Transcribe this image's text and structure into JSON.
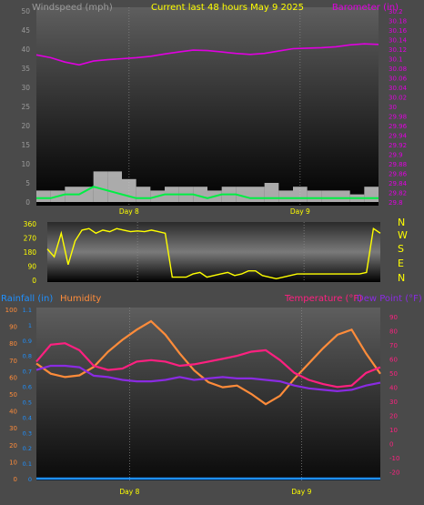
{
  "header": {
    "left_label": "Windspeed (mph)",
    "center_label": "Current last 48 hours May 9 2025",
    "right_label": "Barometer (in)"
  },
  "colors": {
    "background": "#4a4a4a",
    "plot_top": "#5a5a5a",
    "plot_bottom": "#000000",
    "barometer": "#e000e0",
    "wind_gust": "#c8c8c8",
    "wind_avg": "#00ee44",
    "direction": "#ffff00",
    "rainfall": "#1e90ff",
    "humidity": "#ff8c3a",
    "temperature": "#ff2080",
    "dewpoint": "#8a2be2",
    "day_label": "#ffff00",
    "axis_text": "#888888"
  },
  "chart_data": [
    {
      "id": "wind_baro",
      "type": "line",
      "x_range_hours": [
        0,
        48
      ],
      "x_ticks": [
        {
          "hour": 13,
          "label": "Day 8"
        },
        {
          "hour": 37,
          "label": "Day 9"
        }
      ],
      "left_axis": {
        "label": "Windspeed (mph)",
        "ylim": [
          0,
          50
        ],
        "ticks": [
          0,
          5,
          10,
          15,
          20,
          25,
          30,
          35,
          40,
          45,
          50
        ]
      },
      "right_axis": {
        "label": "Barometer (in)",
        "ylim": [
          29.8,
          30.2
        ],
        "ticks": [
          "29.8",
          "29.82",
          "29.84",
          "29.86",
          "29.88",
          "29.9",
          "29.92",
          "29.94",
          "29.96",
          "29.98",
          "30",
          "30.02",
          "30.04",
          "30.06",
          "30.08",
          "30.1",
          "30.12",
          "30.14",
          "30.16",
          "30.18",
          "30.2"
        ]
      },
      "series": [
        {
          "name": "Barometer",
          "axis": "right",
          "x": [
            0,
            2,
            4,
            6,
            8,
            10,
            12,
            14,
            16,
            18,
            20,
            22,
            24,
            26,
            28,
            30,
            32,
            34,
            36,
            38,
            40,
            42,
            44,
            46,
            48
          ],
          "values": [
            30.108,
            30.102,
            30.093,
            30.087,
            30.095,
            30.098,
            30.1,
            30.102,
            30.105,
            30.11,
            30.114,
            30.118,
            30.117,
            30.114,
            30.111,
            30.109,
            30.111,
            30.116,
            30.121,
            30.122,
            30.123,
            30.125,
            30.129,
            30.131,
            30.13
          ]
        },
        {
          "name": "Wind gust",
          "axis": "left",
          "x": [
            0,
            2,
            4,
            6,
            8,
            10,
            12,
            14,
            16,
            18,
            20,
            22,
            24,
            26,
            28,
            30,
            32,
            34,
            36,
            38,
            40,
            42,
            44,
            46,
            48
          ],
          "values": [
            3,
            3,
            4,
            4,
            8,
            8,
            6,
            4,
            3,
            4,
            4,
            4,
            3,
            4,
            4,
            4,
            5,
            3,
            4,
            3,
            3,
            3,
            2,
            4,
            3
          ]
        },
        {
          "name": "Wind avg",
          "axis": "left",
          "x": [
            0,
            2,
            4,
            6,
            8,
            10,
            12,
            14,
            16,
            18,
            20,
            22,
            24,
            26,
            28,
            30,
            32,
            34,
            36,
            38,
            40,
            42,
            44,
            46,
            48
          ],
          "values": [
            1,
            1,
            2,
            2,
            4,
            3,
            2,
            1,
            1,
            2,
            2,
            2,
            1,
            2,
            2,
            1,
            1,
            1,
            1,
            1,
            1,
            1,
            1,
            1,
            1
          ]
        }
      ]
    },
    {
      "id": "direction",
      "type": "line",
      "x_range_hours": [
        0,
        48
      ],
      "ylim": [
        0,
        360
      ],
      "y_ticks": [
        0,
        90,
        180,
        270,
        360
      ],
      "compass_labels": [
        "N",
        "W",
        "S",
        "E",
        "N"
      ],
      "series": [
        {
          "name": "Wind direction",
          "x": [
            0,
            1,
            2,
            3,
            4,
            5,
            6,
            7,
            8,
            9,
            10,
            11,
            12,
            13,
            14,
            15,
            16,
            17,
            18,
            19,
            20,
            21,
            22,
            23,
            24,
            25,
            26,
            27,
            28,
            29,
            30,
            31,
            32,
            33,
            34,
            35,
            36,
            37,
            38,
            39,
            40,
            41,
            42,
            43,
            44,
            45,
            46,
            47,
            48
          ],
          "values": [
            200,
            150,
            300,
            100,
            250,
            320,
            330,
            300,
            320,
            310,
            330,
            320,
            310,
            315,
            310,
            320,
            310,
            300,
            20,
            20,
            20,
            40,
            50,
            20,
            30,
            40,
            50,
            30,
            40,
            60,
            60,
            30,
            20,
            10,
            20,
            30,
            40,
            40,
            40,
            40,
            40,
            40,
            40,
            40,
            40,
            40,
            50,
            330,
            300
          ]
        }
      ]
    },
    {
      "id": "temp_hum",
      "type": "line",
      "x_range_hours": [
        0,
        48
      ],
      "left_axis_humidity": {
        "label": "Humidity",
        "ylim": [
          0,
          100
        ],
        "ticks": [
          0,
          10,
          20,
          30,
          40,
          50,
          60,
          70,
          80,
          90,
          100
        ]
      },
      "left_axis_rain": {
        "label": "Rainfall (in)",
        "ylim": [
          0,
          1.1
        ],
        "ticks": [
          "0",
          "0.1",
          "0.2",
          "0.3",
          "0.4",
          "0.5",
          "0.6",
          "0.7",
          "0.8",
          "0.9",
          "1",
          "1.1"
        ]
      },
      "right_axis": {
        "label_temperature": "Temperature (°F)",
        "label_dewpoint": "Dew Point (°F)",
        "ylim": [
          -25,
          95
        ],
        "ticks": [
          -20,
          -10,
          0,
          10,
          20,
          30,
          40,
          50,
          60,
          70,
          80,
          90
        ]
      },
      "series": [
        {
          "name": "Humidity",
          "axis": "humidity",
          "x": [
            0,
            2,
            4,
            6,
            8,
            10,
            12,
            14,
            16,
            18,
            20,
            22,
            24,
            26,
            28,
            30,
            32,
            34,
            36,
            38,
            40,
            42,
            44,
            46,
            48
          ],
          "values": [
            68,
            62,
            60,
            61,
            66,
            75,
            82,
            88,
            93,
            85,
            74,
            64,
            57,
            54,
            55,
            50,
            44,
            49,
            59,
            68,
            77,
            85,
            88,
            74,
            62
          ]
        },
        {
          "name": "Temperature",
          "axis": "right",
          "x": [
            0,
            2,
            4,
            6,
            8,
            10,
            12,
            14,
            16,
            18,
            20,
            22,
            24,
            26,
            28,
            30,
            32,
            34,
            36,
            38,
            40,
            42,
            44,
            46,
            48
          ],
          "values": [
            58,
            70,
            71,
            66,
            55,
            52,
            53,
            58,
            59,
            58,
            55,
            56,
            58,
            60,
            62,
            65,
            66,
            59,
            50,
            45,
            42,
            40,
            41,
            50,
            54
          ]
        },
        {
          "name": "Dew Point",
          "axis": "right",
          "x": [
            0,
            2,
            4,
            6,
            8,
            10,
            12,
            14,
            16,
            18,
            20,
            22,
            24,
            26,
            28,
            30,
            32,
            34,
            36,
            38,
            40,
            42,
            44,
            46,
            48
          ],
          "values": [
            52,
            55,
            55,
            54,
            48,
            47,
            45,
            44,
            44,
            45,
            47,
            45,
            46,
            47,
            46,
            46,
            45,
            44,
            41,
            39,
            38,
            37,
            38,
            41,
            43
          ]
        },
        {
          "name": "Rainfall",
          "axis": "rain",
          "x": [
            0,
            48
          ],
          "values": [
            0,
            0
          ]
        }
      ]
    }
  ]
}
